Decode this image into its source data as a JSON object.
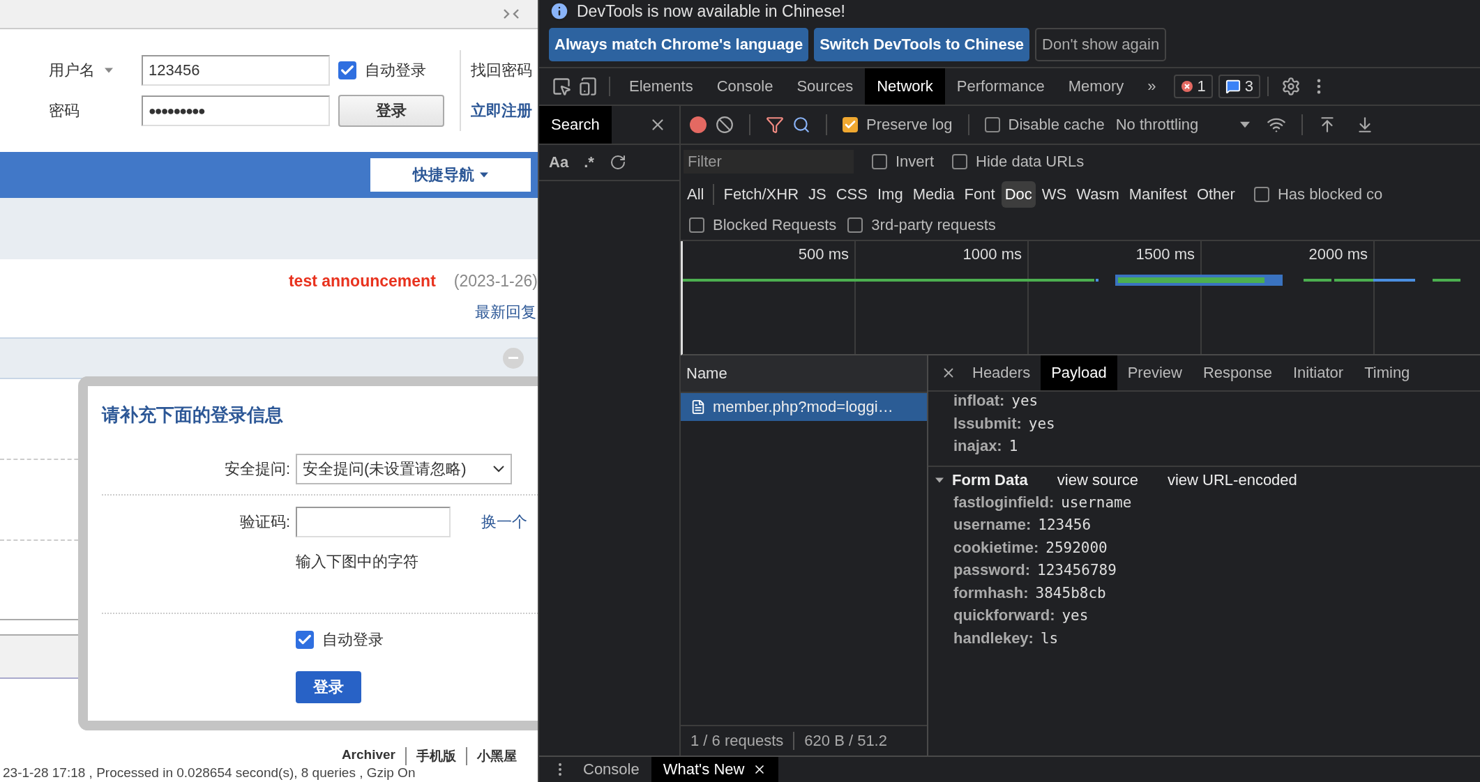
{
  "page": {
    "login": {
      "username_label": "用户名",
      "username_value": "123456",
      "auto_login": {
        "label": "自动登录",
        "checked": true
      },
      "find_password": "找回密码",
      "password_label": "密码",
      "password_value": "●●●●●●●●●",
      "login_button": "登录",
      "register": "立即注册"
    },
    "nav_button": "快捷导航",
    "announcement": {
      "title": "test announcement",
      "date": "(2023-1-26)"
    },
    "latest_reply": "最新回复",
    "footer_links": [
      "Archiver",
      "手机版",
      "小黑屋"
    ],
    "footer_info": "23-1-28 17:18 , Processed in 0.028654 second(s), 8 queries , Gzip On"
  },
  "dialog": {
    "title": "请补充下面的登录信息",
    "question_label": "安全提问:",
    "question_value": "安全提问(未设置请忽略)",
    "captcha_label": "验证码:",
    "captcha_refresh": "换一个",
    "captcha_hint": "输入下图中的字符",
    "auto_login": {
      "label": "自动登录",
      "checked": true
    },
    "submit": "登录"
  },
  "devtools": {
    "infobar": {
      "message": "DevTools is now available in Chinese!",
      "buttons": [
        {
          "label": "Always match Chrome's language",
          "kind": "primary"
        },
        {
          "label": "Switch DevTools to Chinese",
          "kind": "primary"
        },
        {
          "label": "Don't show again",
          "kind": "secondary"
        }
      ]
    },
    "tabs": [
      {
        "label": "Elements",
        "selected": false
      },
      {
        "label": "Console",
        "selected": false
      },
      {
        "label": "Sources",
        "selected": false
      },
      {
        "label": "Network",
        "selected": true
      },
      {
        "label": "Performance",
        "selected": false
      },
      {
        "label": "Memory",
        "selected": false
      }
    ],
    "more_tabs": "»",
    "error_count": "1",
    "message_count": "3",
    "search_panel": {
      "tab": "Search",
      "options": [
        "Aa",
        ".*"
      ]
    },
    "network_toolbar": {
      "preserve_log": {
        "label": "Preserve log",
        "checked": true
      },
      "disable_cache": {
        "label": "Disable cache",
        "checked": false
      },
      "throttling": "No throttling"
    },
    "filter": {
      "placeholder": "Filter",
      "options": [
        {
          "label": "Invert",
          "checked": false
        },
        {
          "label": "Hide data URLs",
          "checked": false
        }
      ]
    },
    "types": [
      {
        "label": "All",
        "selected": false
      },
      {
        "label": "Fetch/XHR",
        "selected": false
      },
      {
        "label": "JS",
        "selected": false
      },
      {
        "label": "CSS",
        "selected": false
      },
      {
        "label": "Img",
        "selected": false
      },
      {
        "label": "Media",
        "selected": false
      },
      {
        "label": "Font",
        "selected": false
      },
      {
        "label": "Doc",
        "selected": true
      },
      {
        "label": "WS",
        "selected": false
      },
      {
        "label": "Wasm",
        "selected": false
      },
      {
        "label": "Manifest",
        "selected": false
      },
      {
        "label": "Other",
        "selected": false
      }
    ],
    "has_blocked": {
      "label": "Has blocked co",
      "checked": false
    },
    "extra_filters": [
      {
        "label": "Blocked Requests",
        "checked": false
      },
      {
        "label": "3rd-party requests",
        "checked": false
      }
    ],
    "timeline": {
      "ticks": [
        "500 ms",
        "1000 ms",
        "1500 ms",
        "2000 ms"
      ]
    },
    "requests": {
      "column": "Name",
      "rows": [
        {
          "name": "member.php?mod=loggi…",
          "selected": true
        }
      ],
      "summary": "1 / 6 requests",
      "transferred": "620 B / 51.2"
    },
    "details": {
      "tabs": [
        {
          "label": "Headers",
          "selected": false
        },
        {
          "label": "Payload",
          "selected": true
        },
        {
          "label": "Preview",
          "selected": false
        },
        {
          "label": "Response",
          "selected": false
        },
        {
          "label": "Initiator",
          "selected": false
        },
        {
          "label": "Timing",
          "selected": false
        }
      ],
      "query_params": [
        {
          "key": "infloat:",
          "value": "yes"
        },
        {
          "key": "lssubmit:",
          "value": "yes"
        },
        {
          "key": "inajax:",
          "value": "1"
        }
      ],
      "form_data": {
        "title": "Form Data",
        "expanded": true,
        "links": [
          "view source",
          "view URL-encoded"
        ],
        "params": [
          {
            "key": "fastloginfield:",
            "value": "username"
          },
          {
            "key": "username:",
            "value": "123456"
          },
          {
            "key": "cookietime:",
            "value": "2592000"
          },
          {
            "key": "password:",
            "value": "123456789"
          },
          {
            "key": "formhash:",
            "value": "3845b8cb"
          },
          {
            "key": "quickforward:",
            "value": "yes"
          },
          {
            "key": "handlekey:",
            "value": "ls"
          }
        ]
      }
    },
    "drawer": {
      "tabs": [
        {
          "label": "Console",
          "selected": false
        },
        {
          "label": "What's New",
          "selected": true
        }
      ]
    }
  }
}
